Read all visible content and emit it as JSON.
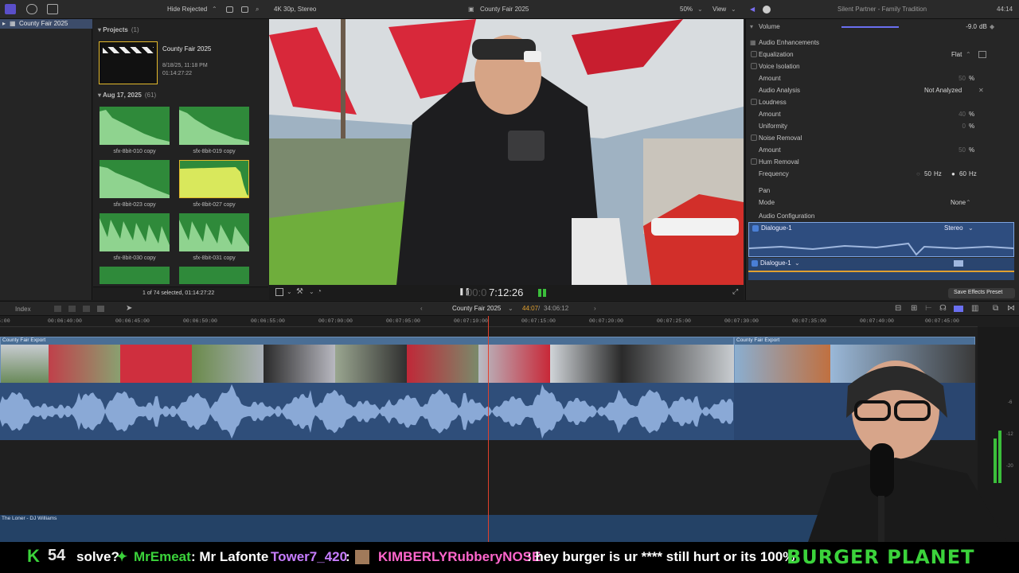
{
  "toolbar": {
    "filter": "Hide Rejected",
    "format": "4K 30p, Stereo",
    "project": "County Fair 2025",
    "zoom": "50%",
    "view": "View",
    "track_title": "Silent Partner - Family Tradition",
    "duration": "44:14"
  },
  "sidebar": {
    "library": "County Fair 2025"
  },
  "browser": {
    "projects_label": "Projects",
    "projects_count": "(1)",
    "project": {
      "name": "County Fair 2025",
      "date": "8/18/25, 11:18 PM",
      "duration": "01:14:27:22"
    },
    "event_label": "Aug 17, 2025",
    "event_count": "(61)",
    "clips": [
      "sfx-8bit-010 copy",
      "sfx-8bit-019 copy",
      "sfx-8bit-023 copy",
      "sfx-8bit-027 copy",
      "sfx-8bit-030 copy",
      "sfx-8bit-031 copy"
    ],
    "status": "1 of 74 selected, 01:14:27:22"
  },
  "viewer": {
    "timecode": "7:12:26",
    "timecode_dim": "00:0"
  },
  "inspector": {
    "volume_label": "Volume",
    "volume_value": "-9.0",
    "volume_unit": "dB",
    "volume_level": 0.55,
    "enhancements_label": "Audio Enhancements",
    "equalization_label": "Equalization",
    "equalization_value": "Flat",
    "voice_isolation_label": "Voice Isolation",
    "amount_label": "Amount",
    "amount_vi": "50",
    "analysis_label": "Audio Analysis",
    "analysis_value": "Not Analyzed",
    "loudness_label": "Loudness",
    "amount_loud": "40",
    "uniformity_label": "Uniformity",
    "uniformity_value": "0",
    "noise_label": "Noise Removal",
    "amount_noise": "50",
    "hum_label": "Hum Removal",
    "frequency_label": "Frequency",
    "freq_50": "50",
    "freq_60": "60",
    "hz": "Hz",
    "percent": "%",
    "pan_label": "Pan",
    "mode_label": "Mode",
    "mode_value": "None",
    "config_label": "Audio Configuration",
    "dialogue1": "Dialogue-1",
    "stereo": "Stereo",
    "dialogue2": "Dialogue-1",
    "save_preset": "Save Effects Preset"
  },
  "timeline": {
    "index": "Index",
    "project": "County Fair 2025",
    "position": "44:07",
    "total": "34:06:12",
    "ticks": [
      "00:06:40:00",
      "00:06:45:00",
      "00:06:50:00",
      "00:06:55:00",
      "00:07:00:00",
      "00:07:05:00",
      "00:07:10:00",
      "00:07:15:00",
      "00:07:20:00",
      "00:07:25:00",
      "00:07:30:00",
      "00:07:35:00",
      "00:07:40:00",
      "00:07:45:00"
    ],
    "clip1": "County Fair Export",
    "clip2": "County Fair Export",
    "music": "The Loner - DJ Williams"
  },
  "ticker": {
    "count": "54",
    "text1": "solve?",
    "user1": "MrEmeat",
    "msg1": ": Mr Lafonte",
    "user2": "Tower7_420",
    "msg2": ":",
    "user3": "KIMBERLYRubberyNOSE",
    "msg3": ": hey burger is ur **** still hurt or its 100%",
    "brand": "BURGER PLANET"
  }
}
